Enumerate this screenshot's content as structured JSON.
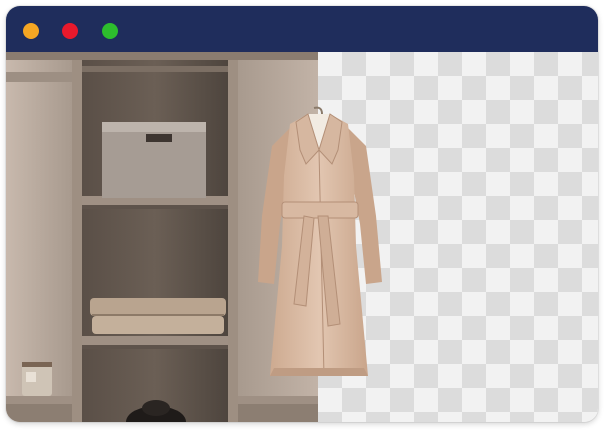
{
  "window": {
    "controls": [
      {
        "name": "minimize",
        "color": "#f5a623"
      },
      {
        "name": "close",
        "color": "#e8192c"
      },
      {
        "name": "maximize",
        "color": "#2dbd2d"
      }
    ]
  },
  "editor": {
    "split_view": [
      "original-photo",
      "background-removed"
    ],
    "subject": "coat-icon",
    "transparency_pattern": "checkerboard",
    "colors": {
      "titlebar": "#1f2d5c",
      "closet_wood": "#8c7c6e",
      "coat": "#dcbfa8",
      "checker_light": "#f2f2f2",
      "checker_dark": "#dcdcdc"
    }
  }
}
